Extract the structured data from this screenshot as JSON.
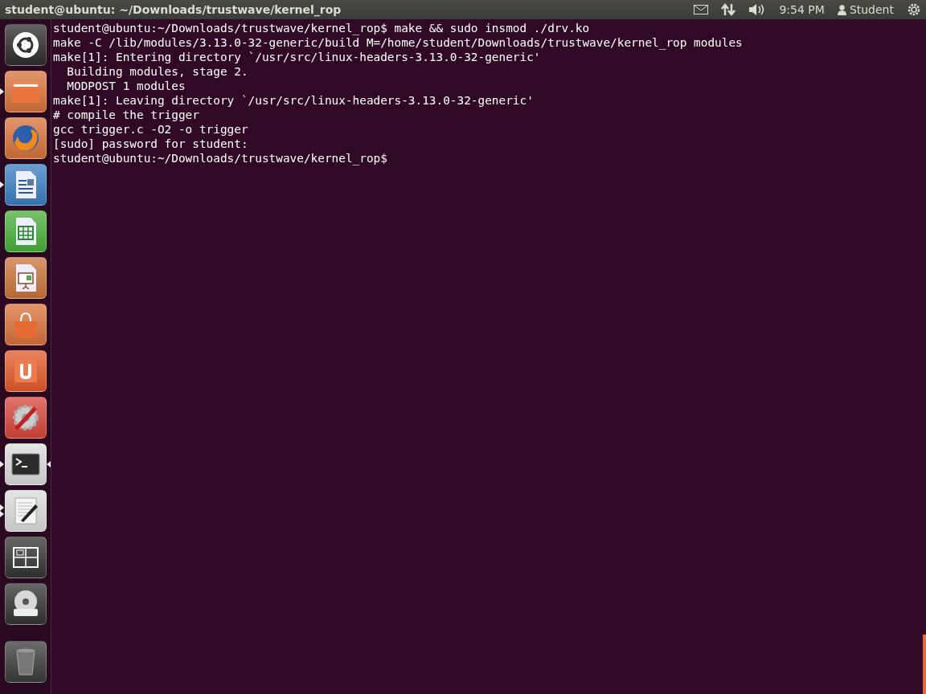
{
  "panel": {
    "title": "student@ubuntu: ~/Downloads/trustwave/kernel_rop",
    "clock": "9:54 PM",
    "user": "Student"
  },
  "launcher": {
    "items": [
      {
        "kind": "dash",
        "running": false,
        "focused": false
      },
      {
        "kind": "files",
        "running": true,
        "multi_window": false,
        "focused": false
      },
      {
        "kind": "browser",
        "running": false,
        "focused": false
      },
      {
        "kind": "writer",
        "running": true,
        "multi_window": false,
        "focused": false
      },
      {
        "kind": "calc",
        "running": false,
        "focused": false
      },
      {
        "kind": "impress",
        "running": false,
        "focused": false
      },
      {
        "kind": "store",
        "running": false,
        "focused": false
      },
      {
        "kind": "cloud",
        "running": false,
        "focused": false
      },
      {
        "kind": "settings",
        "running": false,
        "focused": false
      },
      {
        "kind": "terminal",
        "running": true,
        "multi_window": false,
        "focused": true
      },
      {
        "kind": "editor",
        "running": true,
        "multi_window": true,
        "focused": false
      },
      {
        "kind": "workspaces",
        "running": false,
        "focused": false
      },
      {
        "kind": "dvd",
        "running": false,
        "focused": false
      },
      {
        "kind": "trash",
        "running": false,
        "focused": false
      }
    ]
  },
  "terminal": {
    "lines": [
      "student@ubuntu:~/Downloads/trustwave/kernel_rop$ make && sudo insmod ./drv.ko",
      "make -C /lib/modules/3.13.0-32-generic/build M=/home/student/Downloads/trustwave/kernel_rop modules",
      "make[1]: Entering directory `/usr/src/linux-headers-3.13.0-32-generic'",
      "  Building modules, stage 2.",
      "  MODPOST 1 modules",
      "make[1]: Leaving directory `/usr/src/linux-headers-3.13.0-32-generic'",
      "# compile the trigger",
      "gcc trigger.c -O2 -o trigger",
      "[sudo] password for student:",
      "student@ubuntu:~/Downloads/trustwave/kernel_rop$"
    ]
  }
}
